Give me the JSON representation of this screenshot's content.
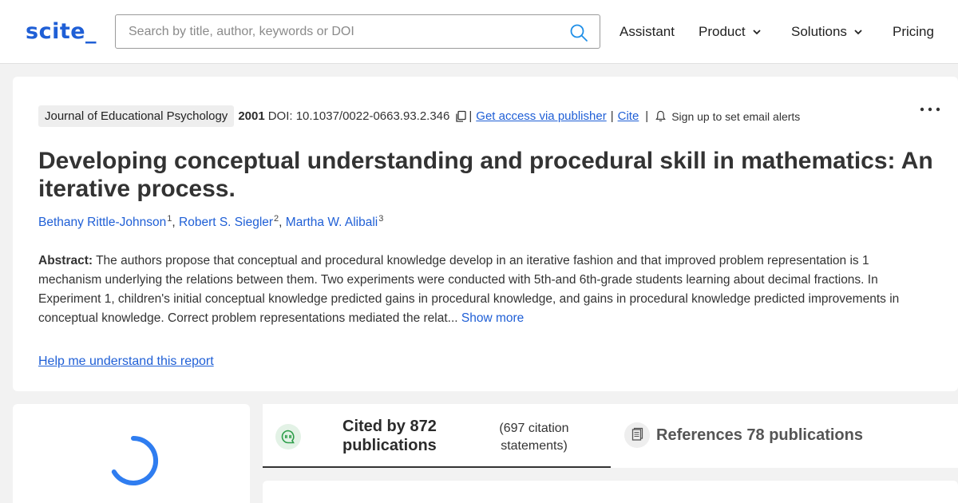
{
  "header": {
    "logo": "scite_",
    "search_placeholder": "Search by title, author, keywords or DOI",
    "nav": {
      "assistant": "Assistant",
      "product": "Product",
      "solutions": "Solutions",
      "pricing": "Pricing"
    }
  },
  "paper": {
    "journal": "Journal of Educational Psychology",
    "year": "2001",
    "doi": "DOI: 10.1037/0022-0663.93.2.346",
    "sep": "|",
    "access_link": "Get access via publisher",
    "cite_link": "Cite",
    "alerts": "Sign up to set email alerts",
    "title": "Developing conceptual understanding and procedural skill in mathematics: An iterative process.",
    "authors": [
      {
        "name": "Bethany Rittle-Johnson",
        "sup": "1"
      },
      {
        "name": "Robert S. Siegler",
        "sup": "2"
      },
      {
        "name": "Martha W. Alibali",
        "sup": "3"
      }
    ],
    "author_sep": ", ",
    "abstract_label": "Abstract:",
    "abstract_text": " The authors propose that conceptual and procedural knowledge develop in an iterative fashion and that improved problem representation is 1 mechanism underlying the relations between them. Two experiments were conducted with 5th-and 6th-grade students learning about decimal fractions. In Experiment 1, children's initial conceptual knowledge predicted gains in procedural knowledge, and gains in procedural knowledge predicted improvements in conceptual knowledge. Correct problem representations mediated the relat...",
    "show_more": " Show more",
    "help_link": "Help me understand this report"
  },
  "tabs": {
    "cited_label": "Cited by 872 publications",
    "cited_statements": "(697 citation statements)",
    "references_label": "References 78 publications"
  },
  "colors": {
    "accent": "#1f5fd6",
    "spinner": "#2f7df0",
    "cite_badge": "#2e9e4a"
  }
}
